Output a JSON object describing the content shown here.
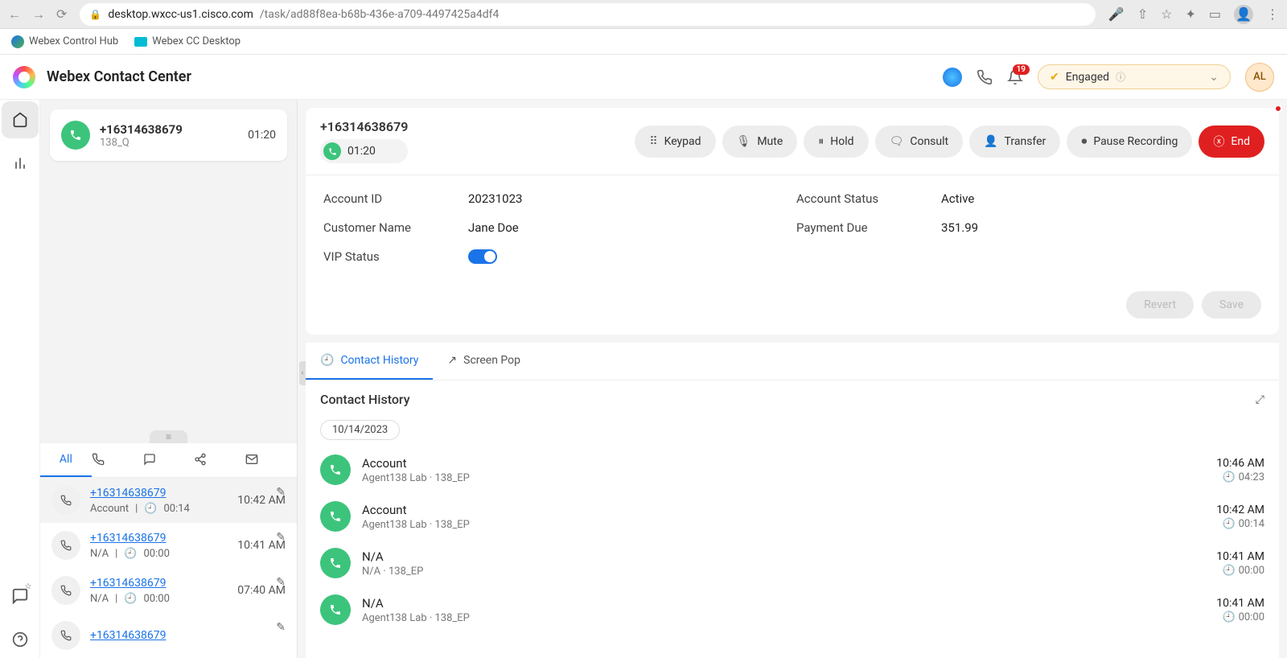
{
  "browser": {
    "url_domain": "desktop.wxcc-us1.cisco.com",
    "url_path": "/task/ad88f8ea-b68b-436e-a709-4497425a4df4"
  },
  "bookmarks": [
    {
      "label": "Webex Control Hub"
    },
    {
      "label": "Webex CC Desktop"
    }
  ],
  "header": {
    "title": "Webex Contact Center",
    "notification_count": "19",
    "status_label": "Engaged",
    "user_initials": "AL"
  },
  "task": {
    "number": "+16314638679",
    "queue": "138_Q",
    "timer": "01:20"
  },
  "call": {
    "number": "+16314638679",
    "timer": "01:20",
    "buttons": {
      "keypad": "Keypad",
      "mute": "Mute",
      "hold": "Hold",
      "consult": "Consult",
      "transfer": "Transfer",
      "pause": "Pause Recording",
      "end": "End"
    }
  },
  "customer": {
    "labels": {
      "account_id": "Account ID",
      "customer_name": "Customer Name",
      "vip_status": "VIP Status",
      "account_status": "Account Status",
      "payment_due": "Payment Due"
    },
    "values": {
      "account_id": "20231023",
      "customer_name": "Jane Doe",
      "account_status": "Active",
      "payment_due": "351.99"
    },
    "actions": {
      "revert": "Revert",
      "save": "Save"
    }
  },
  "filter_tabs": {
    "all": "All"
  },
  "left_history": [
    {
      "number": "+16314638679",
      "wrap": "Account",
      "dur": "00:14",
      "time": "10:42 AM"
    },
    {
      "number": "+16314638679",
      "wrap": "N/A",
      "dur": "00:00",
      "time": "10:41 AM"
    },
    {
      "number": "+16314638679",
      "wrap": "N/A",
      "dur": "00:00",
      "time": "07:40 AM"
    },
    {
      "number": "+16314638679",
      "wrap": "",
      "dur": "",
      "time": ""
    }
  ],
  "tabs": {
    "contact_history": "Contact History",
    "screen_pop": "Screen Pop"
  },
  "contact_history": {
    "title": "Contact History",
    "date": "10/14/2023",
    "entries": [
      {
        "main": "Account",
        "sub": "Agent138 Lab · 138_EP",
        "time": "10:46 AM",
        "dur": "04:23"
      },
      {
        "main": "Account",
        "sub": "Agent138 Lab · 138_EP",
        "time": "10:42 AM",
        "dur": "00:14"
      },
      {
        "main": "N/A",
        "sub": "N/A · 138_EP",
        "time": "10:41 AM",
        "dur": "00:00"
      },
      {
        "main": "N/A",
        "sub": "Agent138 Lab · 138_EP",
        "time": "10:41 AM",
        "dur": "00:00"
      }
    ]
  }
}
